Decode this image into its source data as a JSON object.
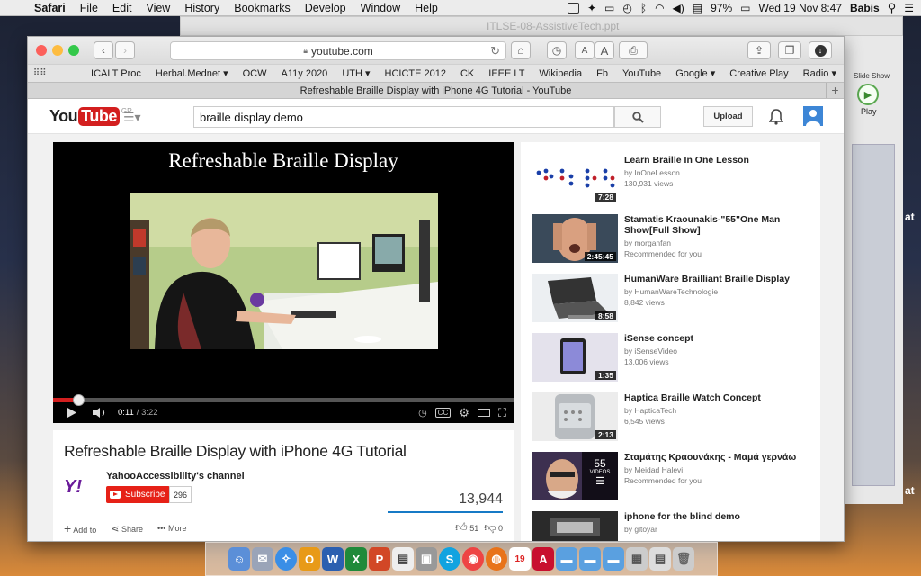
{
  "menubar": {
    "items": [
      "Safari",
      "File",
      "Edit",
      "View",
      "History",
      "Bookmarks",
      "Develop",
      "Window",
      "Help"
    ],
    "battery": "97%",
    "datetime": "Wed 19 Nov  8:47",
    "user": "Babis"
  },
  "background_window": {
    "title": "ITLSE-08-AssistiveTech.ppt",
    "slide_show_label": "Slide Show",
    "play_label": "Play",
    "edge_text": "at"
  },
  "safari": {
    "url": "youtube.com",
    "bookmarks": [
      "ICALT Proc",
      "Herbal.Mednet",
      "OCW",
      "A11y 2020",
      "UTH",
      "HCICTE 2012",
      "CK",
      "IEEE LT",
      "Wikipedia",
      "Fb",
      "YouTube",
      "Google",
      "Creative Play",
      "Radio"
    ],
    "bookmark_dropdown_indices": [
      1,
      4,
      11,
      13
    ],
    "tab_title": "Refreshable Braille Display with iPhone 4G Tutorial - YouTube"
  },
  "youtube": {
    "logo_you": "You",
    "logo_tube": "Tube",
    "region": "GR",
    "search_query": "braille display demo",
    "upload_label": "Upload",
    "player": {
      "overlay_title": "Refreshable Braille Display",
      "current_time": "0:11",
      "duration": "/ 3:22",
      "progress_fraction": 0.055
    },
    "video": {
      "title": "Refreshable Braille Display with iPhone 4G Tutorial",
      "channel": "YahooAccessibility's channel",
      "subscribe_label": "Subscribe",
      "subscriber_count": "296",
      "views": "13,944",
      "add_to_label": "Add to",
      "share_label": "Share",
      "more_label": "More",
      "likes": "51",
      "dislikes": "0"
    },
    "related": [
      {
        "title": "Learn Braille In One Lesson",
        "channel": "by InOneLesson",
        "meta": "130,931 views",
        "duration": "7:28"
      },
      {
        "title": "Stamatis Kraounakis-\"55\"One Man Show[Full Show]",
        "channel": "by morganfan",
        "meta": "Recommended for you",
        "duration": "2:45:45"
      },
      {
        "title": "HumanWare Brailliant Braille Display",
        "channel": "by HumanWareTechnologie",
        "meta": "8,842 views",
        "duration": "8:58"
      },
      {
        "title": "iSense concept",
        "channel": "by iSenseVideo",
        "meta": "13,006 views",
        "duration": "1:35"
      },
      {
        "title": "Haptica Braille Watch Concept",
        "channel": "by HapticaTech",
        "meta": "6,545 views",
        "duration": "2:13"
      },
      {
        "title": "Σταμάτης Κραουνάκης - Μαμά γερνάω",
        "channel": "by Meidad Halevi",
        "meta": "Recommended for you",
        "playlist_count": "55",
        "playlist_label": "VIDEOS"
      },
      {
        "title": "iphone for the blind demo",
        "channel": "by gltoyar",
        "meta": ""
      }
    ]
  },
  "colors": {
    "youtube_red": "#e62117",
    "link_blue": "#167ac6"
  }
}
